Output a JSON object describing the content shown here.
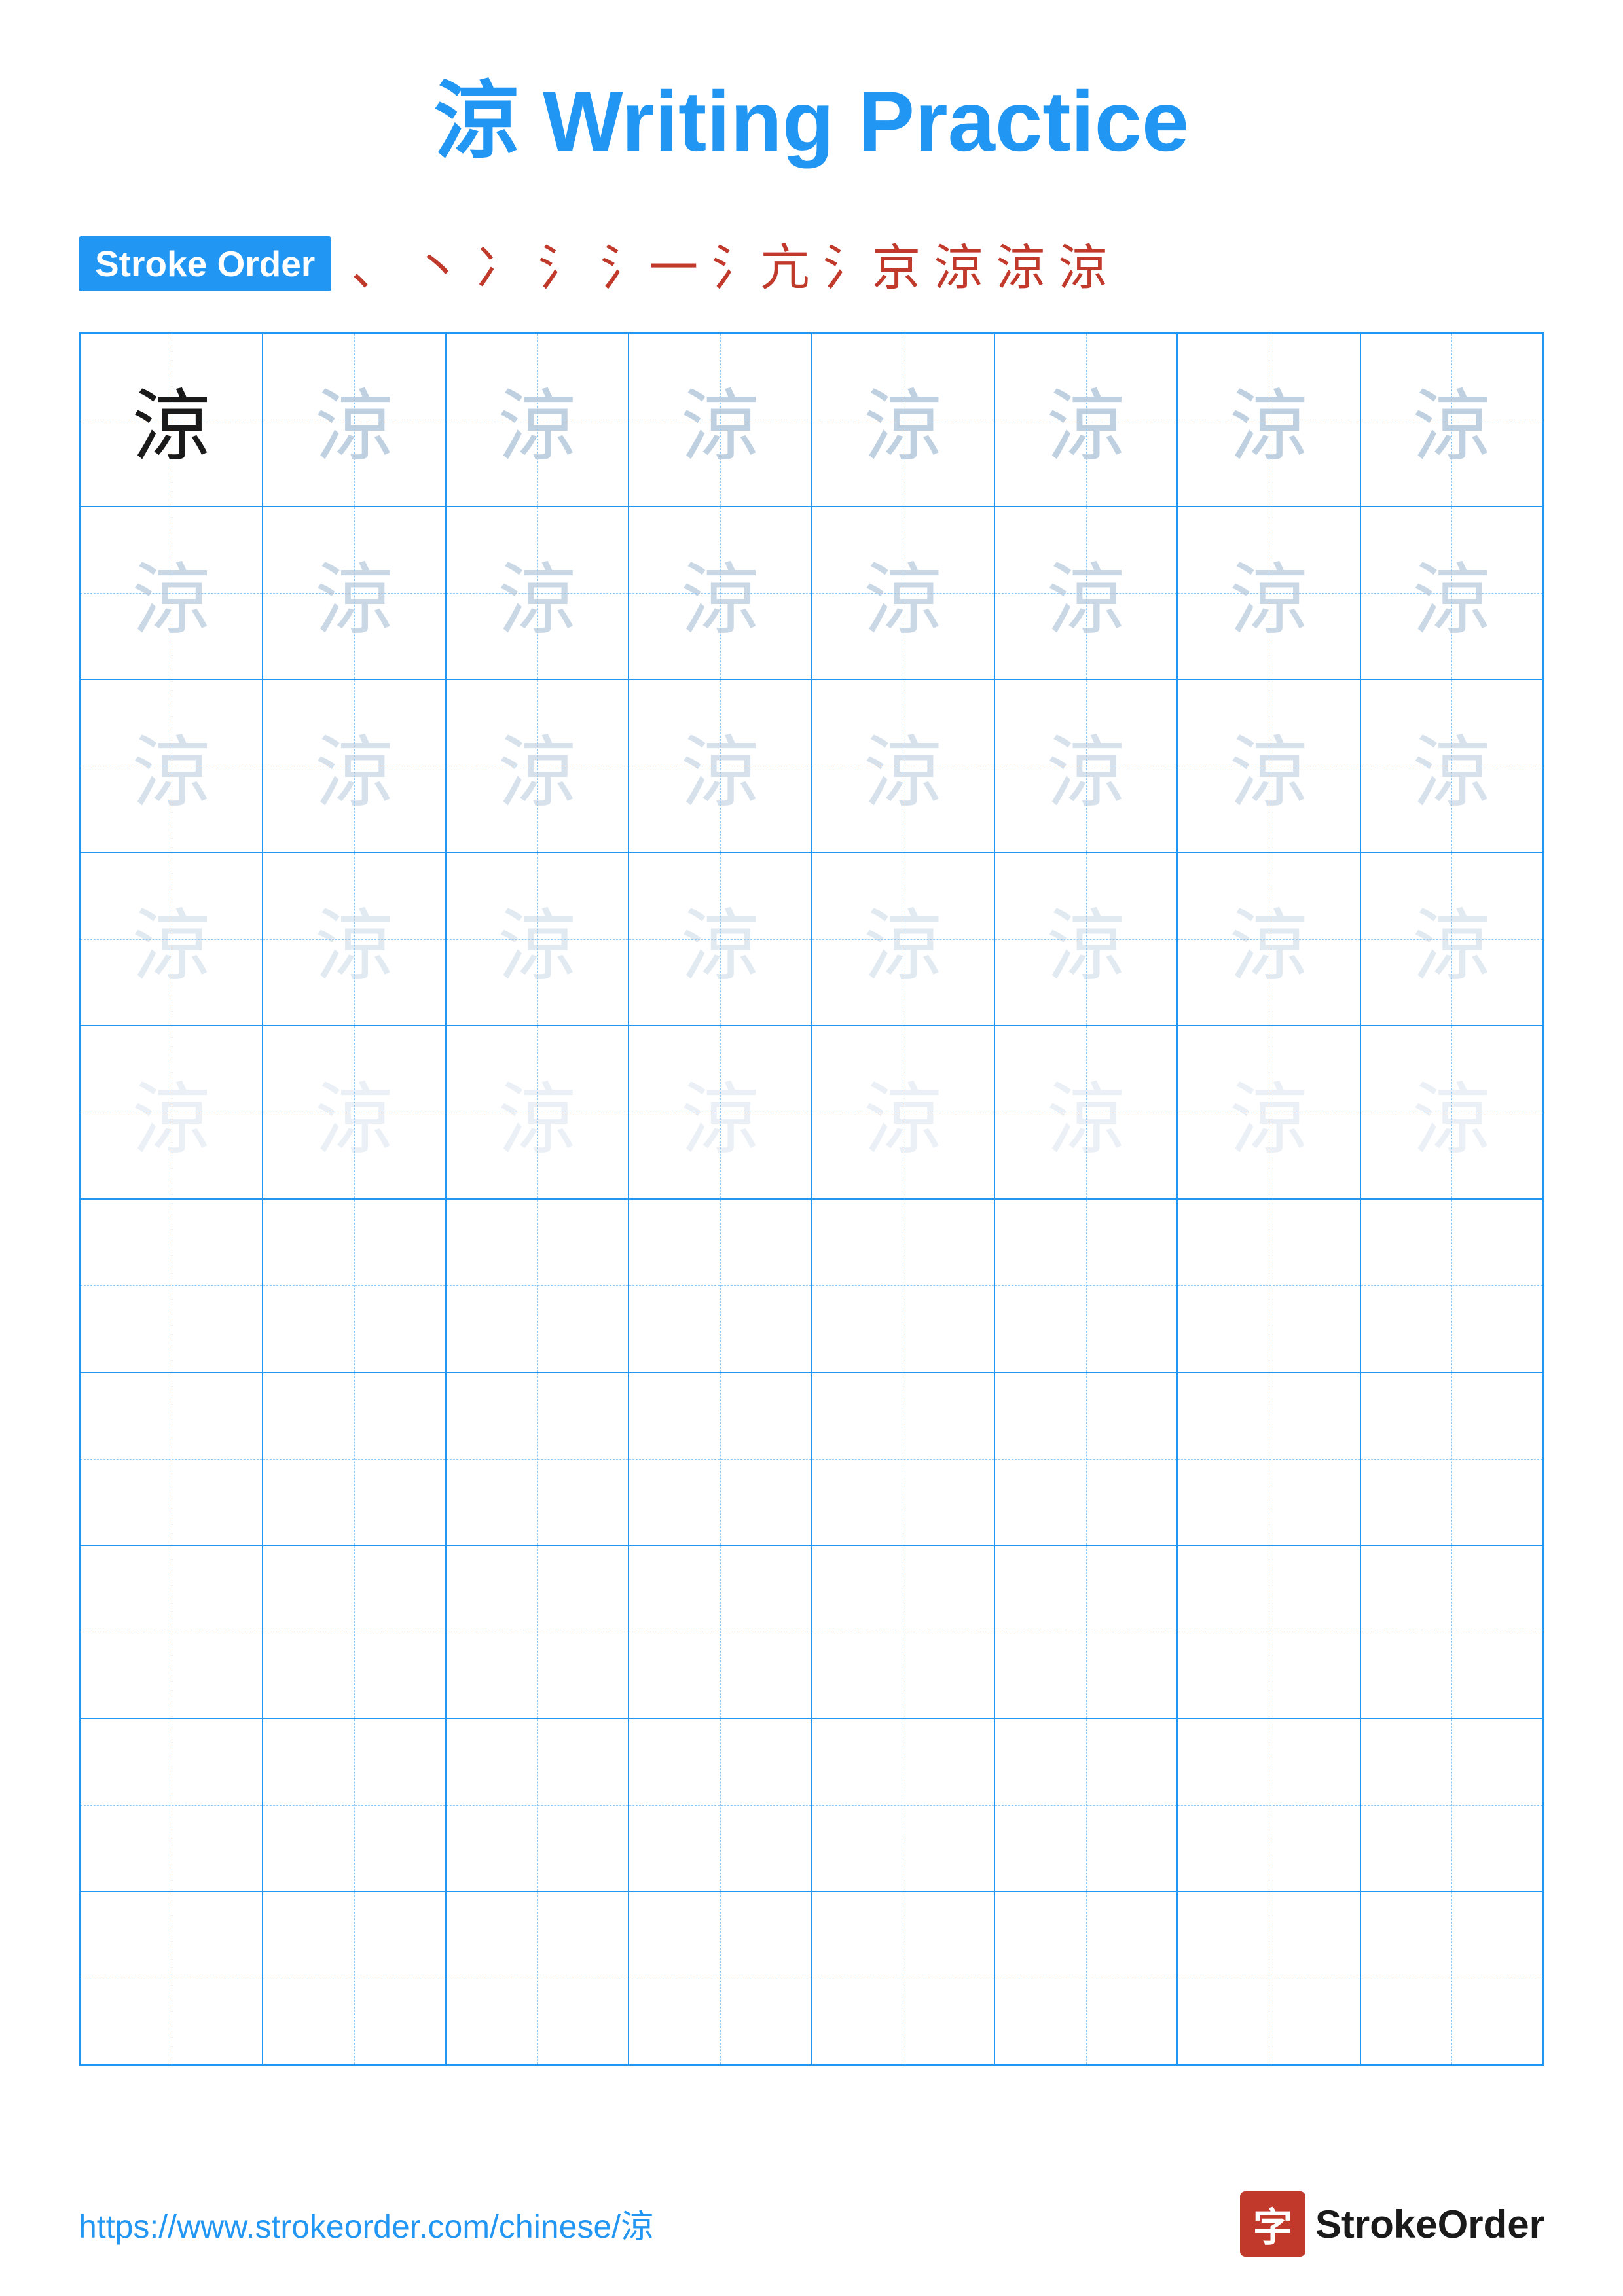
{
  "page": {
    "title": "涼 Writing Practice",
    "title_char": "涼",
    "title_text": " Writing Practice",
    "stroke_order": {
      "label": "Stroke Order",
      "chars": [
        "、",
        "丶",
        "冫",
        "冫`",
        "冫户",
        "冫扩",
        "冫扩`",
        "冫扩亦",
        "涼`",
        "涼",
        "涼"
      ]
    },
    "character": "涼",
    "grid_rows": 10,
    "grid_cols": 8,
    "practice_rows_with_char": 5,
    "footer": {
      "url": "https://www.strokeorder.com/chinese/涼",
      "brand_icon": "字",
      "brand_name": "StrokeOrder"
    }
  }
}
